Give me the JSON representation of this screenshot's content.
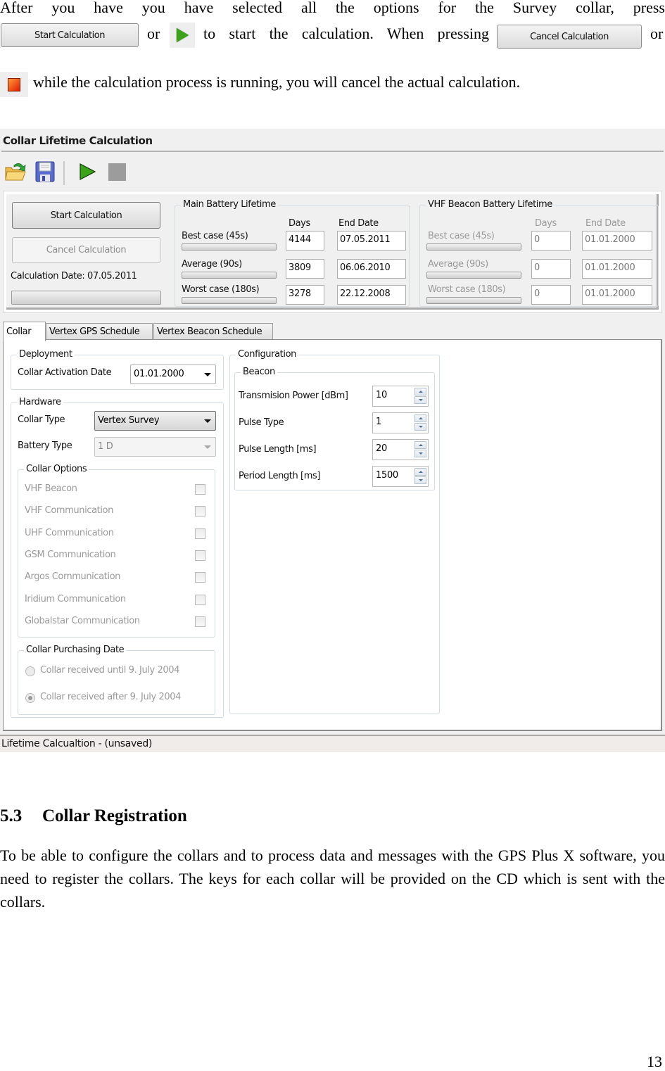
{
  "intro": {
    "line1": "After you have you have selected all the options for the Survey collar, press",
    "or1": "or",
    "mid": "to start the calculation. When pressing",
    "or2": "or",
    "line3": "while the calculation process is running, you will cancel the actual calculation.",
    "start_button_label": "Start Calculation",
    "cancel_button_label": "Cancel Calculation"
  },
  "window": {
    "title": "Collar Lifetime Calculation",
    "toolbar": {
      "icons": [
        "open-folder-icon",
        "save-icon",
        "play-icon",
        "stop-icon"
      ]
    },
    "controls": {
      "start_label": "Start Calculation",
      "cancel_label": "Cancel Calculation",
      "calc_date": "Calculation Date: 07.05.2011"
    },
    "main_battery": {
      "title": "Main Battery Lifetime",
      "col_days": "Days",
      "col_end": "End Date",
      "rows": [
        {
          "label": "Best case (45s)",
          "days": "4144",
          "end": "07.05.2011"
        },
        {
          "label": "Average (90s)",
          "days": "3809",
          "end": "06.06.2010"
        },
        {
          "label": "Worst case (180s)",
          "days": "3278",
          "end": "22.12.2008"
        }
      ]
    },
    "vhf_battery": {
      "title": "VHF Beacon Battery Lifetime",
      "col_days": "Days",
      "col_end": "End Date",
      "rows": [
        {
          "label": "Best case (45s)",
          "days": "0",
          "end": "01.01.2000"
        },
        {
          "label": "Average (90s)",
          "days": "0",
          "end": "01.01.2000"
        },
        {
          "label": "Worst case (180s)",
          "days": "0",
          "end": "01.01.2000"
        }
      ]
    },
    "tabs": [
      "Collar",
      "Vertex GPS Schedule",
      "Vertex Beacon Schedule"
    ],
    "deployment": {
      "title": "Deployment",
      "activation_label": "Collar Activation Date",
      "activation_value": "01.01.2000"
    },
    "hardware": {
      "title": "Hardware",
      "collar_type_label": "Collar Type",
      "collar_type_value": "Vertex Survey",
      "battery_type_label": "Battery Type",
      "battery_type_value": "1 D"
    },
    "collar_options": {
      "title": "Collar Options",
      "items": [
        {
          "label": "VHF Beacon",
          "checked": false
        },
        {
          "label": "VHF Communication",
          "checked": false
        },
        {
          "label": "UHF Communication",
          "checked": false
        },
        {
          "label": "GSM Communication",
          "checked": false
        },
        {
          "label": "Argos Communication",
          "checked": false
        },
        {
          "label": "Iridium Communication",
          "checked": false
        },
        {
          "label": "Globalstar Communication",
          "checked": false
        }
      ]
    },
    "purchasing": {
      "title": "Collar Purchasing Date",
      "options": [
        {
          "label": "Collar received until 9. July 2004",
          "checked": false
        },
        {
          "label": "Collar received after 9. July 2004",
          "checked": true
        }
      ]
    },
    "configuration": {
      "title": "Configuration",
      "beacon_title": "Beacon",
      "fields": [
        {
          "label": "Transmision Power [dBm]",
          "value": "10"
        },
        {
          "label": "Pulse Type",
          "value": "1"
        },
        {
          "label": "Pulse Length [ms]",
          "value": "20"
        },
        {
          "label": "Period Length [ms]",
          "value": "1500"
        }
      ]
    },
    "status": "Lifetime Calcualtion - (unsaved)"
  },
  "section": {
    "number": "5.3",
    "title": "Collar Registration",
    "body": "To be able to configure the collars and to process data and messages with the GPS Plus X software, you need to register the collars. The keys for each collar will be provided on the CD which is sent with the collars."
  },
  "page_number": "13"
}
